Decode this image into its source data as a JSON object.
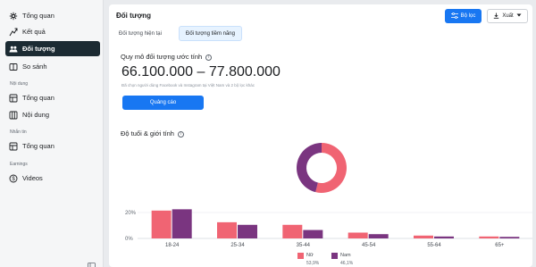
{
  "sidebar": {
    "items": [
      {
        "label": "Tổng quan",
        "icon": "overview-icon"
      },
      {
        "label": "Kết quả",
        "icon": "results-icon"
      },
      {
        "label": "Đối tượng",
        "icon": "audience-icon",
        "active": true
      },
      {
        "label": "So sánh",
        "icon": "compare-icon"
      }
    ],
    "sections": [
      {
        "title": "Nội dung",
        "items": [
          {
            "label": "Tổng quan"
          },
          {
            "label": "Nội dung"
          }
        ]
      },
      {
        "title": "Nhắn tin",
        "items": [
          {
            "label": "Tổng quan"
          }
        ]
      },
      {
        "title": "Earnings",
        "items": [
          {
            "label": "Videos"
          }
        ]
      }
    ]
  },
  "header": {
    "title": "Đối tượng",
    "filter_label": "Bộ lọc",
    "export_label": "Xuất"
  },
  "tabs": [
    {
      "label": "Đối tượng hiện tại"
    },
    {
      "label": "Đối tượng tiềm năng",
      "selected": true
    }
  ],
  "reach": {
    "title": "Quy mô đối tượng ước tính",
    "value": "66.100.000 – 77.800.000",
    "description": "Đã chọn người dùng Facebook và Instagram tại Việt Nam và 2 bộ lọc khác",
    "button_label": "Quảng cáo"
  },
  "demographics": {
    "title": "Độ tuổi & giới tính"
  },
  "colors": {
    "female": "#f06473",
    "male": "#7a3580",
    "primary": "#1877f2",
    "active_nav": "#1c2b33"
  },
  "chart_data": [
    {
      "type": "pie",
      "labels": [
        "Nữ",
        "Nam"
      ],
      "values": [
        53.9,
        46.1
      ]
    },
    {
      "type": "bar",
      "categories": [
        "18-24",
        "25-34",
        "35-44",
        "45-54",
        "55-64",
        "65+"
      ],
      "series": [
        {
          "name": "Nữ",
          "values": [
            21.5,
            12.5,
            10.5,
            4.5,
            2.2,
            1.5
          ]
        },
        {
          "name": "Nam",
          "values": [
            22.5,
            10.5,
            6.5,
            3.3,
            1.5,
            1.2
          ]
        }
      ],
      "yticks": [
        "20%",
        "0%"
      ],
      "ylim": [
        0,
        30
      ],
      "legend": [
        {
          "label": "Nữ",
          "pct": "53,9%"
        },
        {
          "label": "Nam",
          "pct": "46,1%"
        }
      ]
    }
  ]
}
